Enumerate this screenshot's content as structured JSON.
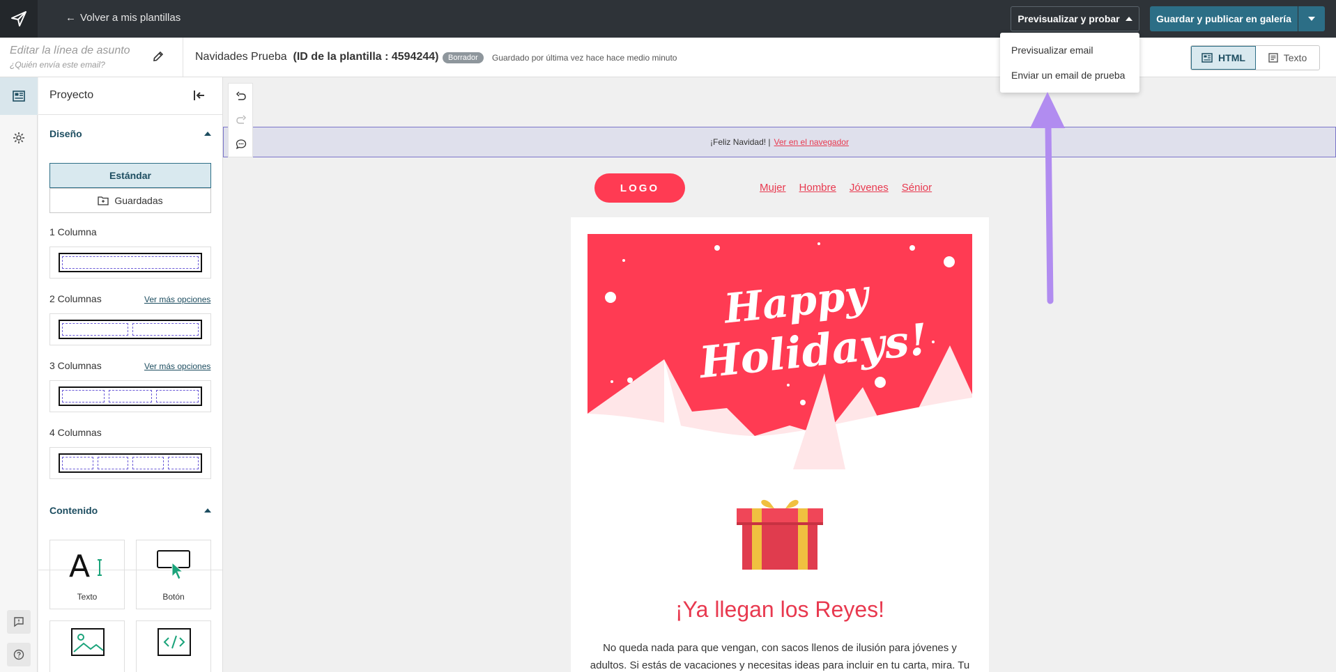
{
  "topbar": {
    "back_label": "Volver a mis plantillas",
    "preview_button": "Previsualizar y probar",
    "publish_button": "Guardar y publicar en galería"
  },
  "preview_menu": {
    "items": [
      "Previsualizar email",
      "Enviar un email de prueba"
    ]
  },
  "subbar": {
    "subject_placeholder": "Editar la línea de asunto",
    "sender_placeholder": "¿Quién envía este email?",
    "template_name": "Navidades Prueba",
    "template_id": "(ID de la plantilla : 4594244)",
    "status_badge": "Borrador",
    "saved_text": "Guardado por última vez hace hace medio minuto",
    "view_html": "HTML",
    "view_text": "Texto"
  },
  "panel": {
    "title": "Proyecto",
    "design_section": "Diseño",
    "standard_tab": "Estándar",
    "saved_tab": "Guardadas",
    "layouts": [
      {
        "label": "1 Columna",
        "columns": 1
      },
      {
        "label": "2 Columnas",
        "columns": 2,
        "more": "Ver más opciones"
      },
      {
        "label": "3 Columnas",
        "columns": 3,
        "more": "Ver más opciones"
      },
      {
        "label": "4 Columnas",
        "columns": 4
      }
    ],
    "content_section": "Contenido",
    "blocks": [
      "Texto",
      "Botón"
    ]
  },
  "email": {
    "preheader_text": "¡Feliz Navidad! |",
    "preheader_link": "Ver en el navegador",
    "logo": "LOGO",
    "nav": [
      "Mujer",
      "Hombre",
      "Jóvenes",
      "Sénior"
    ],
    "hero_text_1": "Happy",
    "hero_text_2": "Holidays!",
    "headline": "¡Ya llegan los Reyes!",
    "paragraph": "No queda nada para que vengan, con sacos llenos de ilusión para jóvenes y adultos. Si estás de vacaciones y necesitas ideas para incluir en tu carta, mira. Tu"
  },
  "colors": {
    "topbar": "#2e3338",
    "accent": "#2c6e86",
    "brand_red": "#ff3b53",
    "annotation_arrow": "#b18cf0"
  }
}
